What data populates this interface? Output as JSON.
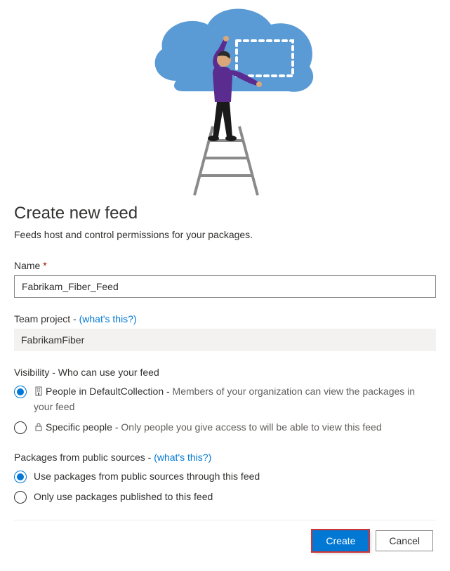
{
  "title": "Create new feed",
  "subtitle": "Feeds host and control permissions for your packages.",
  "name": {
    "label": "Name",
    "required": "*",
    "value": "Fabrikam_Fiber_Feed"
  },
  "teamProject": {
    "label": "Team project -",
    "link": "(what's this?)",
    "value": "FabrikamFiber"
  },
  "visibility": {
    "label": "Visibility - Who can use your feed",
    "options": [
      {
        "primary": "People in DefaultCollection -",
        "secondary": "Members of your organization can view the packages in your feed"
      },
      {
        "primary": "Specific people -",
        "secondary": "Only people you give access to will be able to view this feed"
      }
    ]
  },
  "publicSources": {
    "label": "Packages from public sources -",
    "link": "(what's this?)",
    "options": [
      "Use packages from public sources through this feed",
      "Only use packages published to this feed"
    ]
  },
  "buttons": {
    "create": "Create",
    "cancel": "Cancel"
  }
}
